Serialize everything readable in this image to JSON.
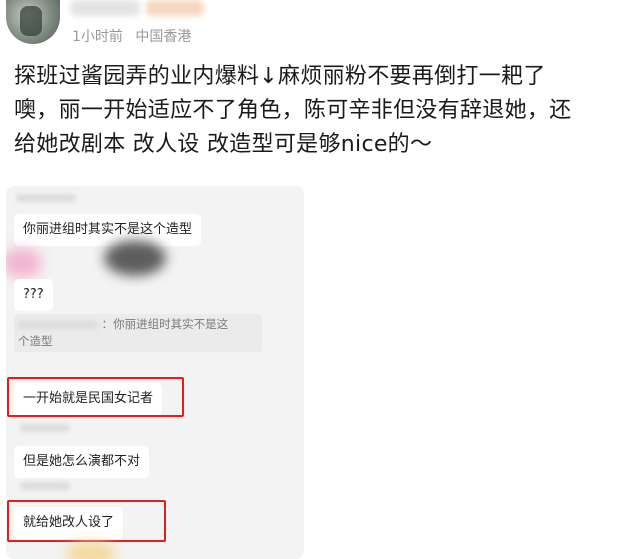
{
  "post": {
    "time": "1小时前",
    "location": "中国香港",
    "text_lines": [
      "探班过酱园弄的业内爆料↓麻烦丽粉不要再倒打一耙了",
      "噢，丽一开始适应不了角色，陈可辛非但没有辞退她，还",
      "给她改剧本 改人设 改造型可是够nice的～"
    ]
  },
  "chat": {
    "msg1": "你丽进组时其实不是这个造型",
    "msg2": "???",
    "quote_line1": "：你丽进组时其实不是这",
    "quote_line2": "个造型",
    "msg3": "一开始就是民国女记者",
    "msg4": "但是她怎么演都不对",
    "msg5": "就给她改人设了"
  },
  "colors": {
    "highlight_box": "#e02020",
    "meta_text": "#9a9a9a",
    "chat_bg": "#f3f3f3"
  }
}
